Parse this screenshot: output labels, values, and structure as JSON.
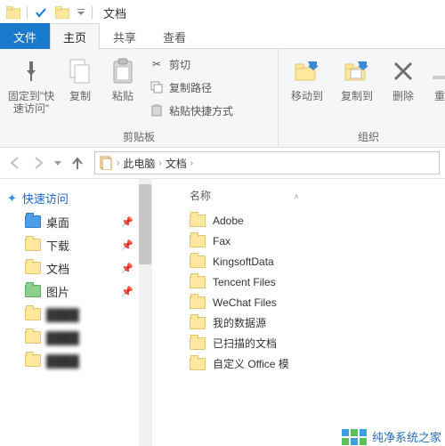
{
  "titlebar": {
    "title": "文档"
  },
  "tabs": {
    "file": "文件",
    "home": "主页",
    "share": "共享",
    "view": "查看"
  },
  "ribbon": {
    "pin": "固定到\"快\n速访问\"",
    "copy": "复制",
    "paste": "粘贴",
    "cut": "剪切",
    "copy_path": "复制路径",
    "paste_shortcut": "粘贴快捷方式",
    "clipboard_group": "剪贴板",
    "move_to": "移动到",
    "copy_to": "复制到",
    "delete": "删除",
    "rename": "重",
    "organize_group": "组织"
  },
  "breadcrumb": {
    "a": "此电脑",
    "b": "文档"
  },
  "sidebar": {
    "quick_access": "快速访问",
    "items": [
      {
        "label": "桌面",
        "color": "blue"
      },
      {
        "label": "下载",
        "color": ""
      },
      {
        "label": "文档",
        "color": ""
      },
      {
        "label": "图片",
        "color": "green"
      }
    ]
  },
  "columns": {
    "name": "名称"
  },
  "files": [
    "Adobe",
    "Fax",
    "KingsoftData",
    "Tencent Files",
    "WeChat Files",
    "我的数据源",
    "已扫描的文档",
    "自定义 Office 模"
  ],
  "watermark": "纯净系统之家"
}
